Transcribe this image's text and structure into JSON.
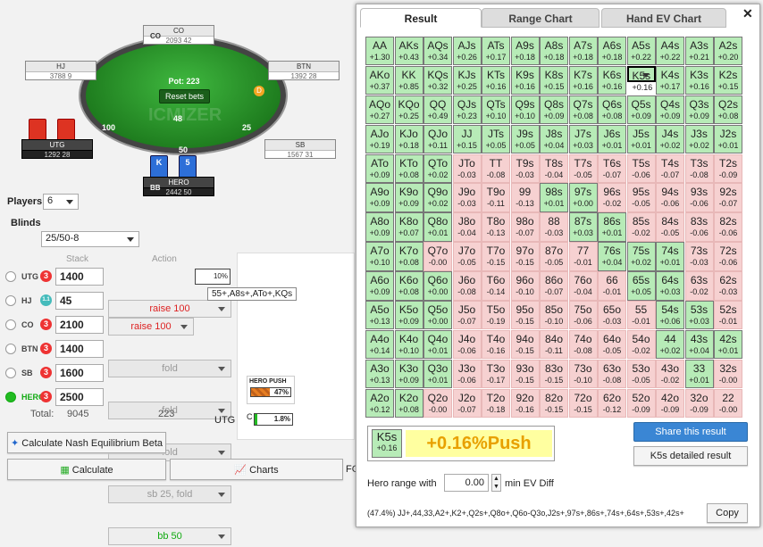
{
  "table": {
    "pot_label": "Pot: 223",
    "reset_label": "Reset bets",
    "center_chips": "48",
    "watermark": "ICMIZER",
    "dealer": "D",
    "bet_utg": "100",
    "bet_btn": "25",
    "bet_bb": "50",
    "seats": [
      {
        "pos": "CO",
        "name": "CO",
        "stack": "2093 42"
      },
      {
        "pos": "HJ",
        "name": "HJ",
        "stack": "3788 9"
      },
      {
        "pos": "BTN",
        "name": "BTN",
        "stack": "1392 28"
      },
      {
        "pos": "UTG",
        "name": "UTG",
        "stack": "1292 28"
      },
      {
        "pos": "SB",
        "name": "SB",
        "stack": "1567 31"
      },
      {
        "pos": "BB",
        "name": "HERO",
        "stack": "2442 50"
      }
    ],
    "hero_cards": [
      "K",
      "5"
    ]
  },
  "controls": {
    "players_label": "Players",
    "players_value": "6",
    "blinds_label": "Blinds",
    "blinds_value": "25/50-8",
    "stack_header": "Stack",
    "action_header": "Action",
    "rows": [
      {
        "pos": "UTG",
        "badge": "3",
        "stack": "1400",
        "action": "raise 100",
        "pct": "10%"
      },
      {
        "pos": "HJ",
        "badge": "1.1",
        "stack": "45",
        "action": "fold"
      },
      {
        "pos": "CO",
        "badge": "3",
        "stack": "2100",
        "action": "fold"
      },
      {
        "pos": "BTN",
        "badge": "3",
        "stack": "1400",
        "action": "fold"
      },
      {
        "pos": "SB",
        "badge": "3",
        "stack": "1600",
        "action": "sb 25, fold"
      },
      {
        "pos": "HERO",
        "badge": "3",
        "stack": "2500",
        "action": "bb 50"
      }
    ],
    "total_label": "Total:",
    "total_stack": "9045",
    "total_action": "223",
    "tooltip": "55+,A8s+,ATo+,KQs",
    "hero_push_label": "HERO PUSH",
    "hero_push_pct": "47%",
    "utg_label": "UTG",
    "call_label": "C",
    "call_pct": "1.8%",
    "nash_button": "Calculate Nash Equilibrium Beta",
    "calculate_button": "Calculate",
    "charts_button": "Charts",
    "fc_label": "FC"
  },
  "panel": {
    "tabs": [
      "Result",
      "Range Chart",
      "Hand EV Chart"
    ],
    "close": "✕",
    "grid": [
      [
        [
          "AA",
          "+1.30",
          "g"
        ],
        [
          "AKs",
          "+0.43",
          "g"
        ],
        [
          "AQs",
          "+0.34",
          "g"
        ],
        [
          "AJs",
          "+0.26",
          "g"
        ],
        [
          "ATs",
          "+0.17",
          "g"
        ],
        [
          "A9s",
          "+0.18",
          "g"
        ],
        [
          "A8s",
          "+0.18",
          "g"
        ],
        [
          "A7s",
          "+0.18",
          "g"
        ],
        [
          "A6s",
          "+0.18",
          "g"
        ],
        [
          "A5s",
          "+0.22",
          "g"
        ],
        [
          "A4s",
          "+0.22",
          "g"
        ],
        [
          "A3s",
          "+0.21",
          "g"
        ],
        [
          "A2s",
          "+0.20",
          "g"
        ]
      ],
      [
        [
          "AKo",
          "+0.37",
          "g"
        ],
        [
          "KK",
          "+0.85",
          "g"
        ],
        [
          "KQs",
          "+0.32",
          "g"
        ],
        [
          "KJs",
          "+0.25",
          "g"
        ],
        [
          "KTs",
          "+0.16",
          "g"
        ],
        [
          "K9s",
          "+0.16",
          "g"
        ],
        [
          "K8s",
          "+0.15",
          "g"
        ],
        [
          "K7s",
          "+0.16",
          "g"
        ],
        [
          "K6s",
          "+0.16",
          "g"
        ],
        [
          "K5s",
          "+0.16",
          "gs"
        ],
        [
          "K4s",
          "+0.17",
          "g"
        ],
        [
          "K3s",
          "+0.16",
          "g"
        ],
        [
          "K2s",
          "+0.15",
          "g"
        ]
      ],
      [
        [
          "AQo",
          "+0.27",
          "g"
        ],
        [
          "KQo",
          "+0.25",
          "g"
        ],
        [
          "QQ",
          "+0.49",
          "g"
        ],
        [
          "QJs",
          "+0.23",
          "g"
        ],
        [
          "QTs",
          "+0.10",
          "g"
        ],
        [
          "Q9s",
          "+0.10",
          "g"
        ],
        [
          "Q8s",
          "+0.09",
          "g"
        ],
        [
          "Q7s",
          "+0.08",
          "g"
        ],
        [
          "Q6s",
          "+0.08",
          "g"
        ],
        [
          "Q5s",
          "+0.09",
          "g"
        ],
        [
          "Q4s",
          "+0.09",
          "g"
        ],
        [
          "Q3s",
          "+0.09",
          "g"
        ],
        [
          "Q2s",
          "+0.08",
          "g"
        ]
      ],
      [
        [
          "AJo",
          "+0.19",
          "g"
        ],
        [
          "KJo",
          "+0.18",
          "g"
        ],
        [
          "QJo",
          "+0.11",
          "g"
        ],
        [
          "JJ",
          "+0.15",
          "g"
        ],
        [
          "JTs",
          "+0.05",
          "g"
        ],
        [
          "J9s",
          "+0.05",
          "g"
        ],
        [
          "J8s",
          "+0.04",
          "g"
        ],
        [
          "J7s",
          "+0.03",
          "g"
        ],
        [
          "J6s",
          "+0.01",
          "g"
        ],
        [
          "J5s",
          "+0.01",
          "g"
        ],
        [
          "J4s",
          "+0.02",
          "g"
        ],
        [
          "J3s",
          "+0.02",
          "g"
        ],
        [
          "J2s",
          "+0.01",
          "g"
        ]
      ],
      [
        [
          "ATo",
          "+0.09",
          "g"
        ],
        [
          "KTo",
          "+0.08",
          "g"
        ],
        [
          "QTo",
          "+0.02",
          "g"
        ],
        [
          "JTo",
          "-0.03",
          "r"
        ],
        [
          "TT",
          "-0.08",
          "r"
        ],
        [
          "T9s",
          "-0.03",
          "r"
        ],
        [
          "T8s",
          "-0.04",
          "r"
        ],
        [
          "T7s",
          "-0.05",
          "r"
        ],
        [
          "T6s",
          "-0.07",
          "r"
        ],
        [
          "T5s",
          "-0.06",
          "r"
        ],
        [
          "T4s",
          "-0.07",
          "r"
        ],
        [
          "T3s",
          "-0.08",
          "r"
        ],
        [
          "T2s",
          "-0.09",
          "r"
        ]
      ],
      [
        [
          "A9o",
          "+0.09",
          "g"
        ],
        [
          "K9o",
          "+0.09",
          "g"
        ],
        [
          "Q9o",
          "+0.02",
          "g"
        ],
        [
          "J9o",
          "-0.03",
          "r"
        ],
        [
          "T9o",
          "-0.11",
          "r"
        ],
        [
          "99",
          "-0.13",
          "r"
        ],
        [
          "98s",
          "+0.01",
          "g"
        ],
        [
          "97s",
          "+0.00",
          "g"
        ],
        [
          "96s",
          "-0.02",
          "r"
        ],
        [
          "95s",
          "-0.05",
          "r"
        ],
        [
          "94s",
          "-0.06",
          "r"
        ],
        [
          "93s",
          "-0.06",
          "r"
        ],
        [
          "92s",
          "-0.07",
          "r"
        ]
      ],
      [
        [
          "A8o",
          "+0.09",
          "g"
        ],
        [
          "K8o",
          "+0.07",
          "g"
        ],
        [
          "Q8o",
          "+0.01",
          "g"
        ],
        [
          "J8o",
          "-0.04",
          "r"
        ],
        [
          "T8o",
          "-0.13",
          "r"
        ],
        [
          "98o",
          "-0.07",
          "r"
        ],
        [
          "88",
          "-0.03",
          "r"
        ],
        [
          "87s",
          "+0.03",
          "g"
        ],
        [
          "86s",
          "+0.01",
          "g"
        ],
        [
          "85s",
          "-0.02",
          "r"
        ],
        [
          "84s",
          "-0.05",
          "r"
        ],
        [
          "83s",
          "-0.06",
          "r"
        ],
        [
          "82s",
          "-0.06",
          "r"
        ]
      ],
      [
        [
          "A7o",
          "+0.10",
          "g"
        ],
        [
          "K7o",
          "+0.08",
          "g"
        ],
        [
          "Q7o",
          "-0.00",
          "r"
        ],
        [
          "J7o",
          "-0.05",
          "r"
        ],
        [
          "T7o",
          "-0.15",
          "r"
        ],
        [
          "97o",
          "-0.15",
          "r"
        ],
        [
          "87o",
          "-0.05",
          "r"
        ],
        [
          "77",
          "-0.01",
          "r"
        ],
        [
          "76s",
          "+0.04",
          "g"
        ],
        [
          "75s",
          "+0.02",
          "g"
        ],
        [
          "74s",
          "+0.01",
          "g"
        ],
        [
          "73s",
          "-0.03",
          "r"
        ],
        [
          "72s",
          "-0.06",
          "r"
        ]
      ],
      [
        [
          "A6o",
          "+0.09",
          "g"
        ],
        [
          "K6o",
          "+0.08",
          "g"
        ],
        [
          "Q6o",
          "+0.00",
          "g"
        ],
        [
          "J6o",
          "-0.08",
          "r"
        ],
        [
          "T6o",
          "-0.14",
          "r"
        ],
        [
          "96o",
          "-0.10",
          "r"
        ],
        [
          "86o",
          "-0.07",
          "r"
        ],
        [
          "76o",
          "-0.04",
          "r"
        ],
        [
          "66",
          "-0.01",
          "r"
        ],
        [
          "65s",
          "+0.05",
          "g"
        ],
        [
          "64s",
          "+0.03",
          "g"
        ],
        [
          "63s",
          "-0.02",
          "r"
        ],
        [
          "62s",
          "-0.03",
          "r"
        ]
      ],
      [
        [
          "A5o",
          "+0.13",
          "g"
        ],
        [
          "K5o",
          "+0.09",
          "g"
        ],
        [
          "Q5o",
          "+0.00",
          "g"
        ],
        [
          "J5o",
          "-0.07",
          "r"
        ],
        [
          "T5o",
          "-0.19",
          "r"
        ],
        [
          "95o",
          "-0.15",
          "r"
        ],
        [
          "85o",
          "-0.10",
          "r"
        ],
        [
          "75o",
          "-0.06",
          "r"
        ],
        [
          "65o",
          "-0.03",
          "r"
        ],
        [
          "55",
          "-0.01",
          "r"
        ],
        [
          "54s",
          "+0.06",
          "g"
        ],
        [
          "53s",
          "+0.03",
          "g"
        ],
        [
          "52s",
          "-0.01",
          "r"
        ]
      ],
      [
        [
          "A4o",
          "+0.14",
          "g"
        ],
        [
          "K4o",
          "+0.10",
          "g"
        ],
        [
          "Q4o",
          "+0.01",
          "g"
        ],
        [
          "J4o",
          "-0.06",
          "r"
        ],
        [
          "T4o",
          "-0.16",
          "r"
        ],
        [
          "94o",
          "-0.15",
          "r"
        ],
        [
          "84o",
          "-0.11",
          "r"
        ],
        [
          "74o",
          "-0.08",
          "r"
        ],
        [
          "64o",
          "-0.05",
          "r"
        ],
        [
          "54o",
          "-0.02",
          "r"
        ],
        [
          "44",
          "+0.02",
          "g"
        ],
        [
          "43s",
          "+0.04",
          "g"
        ],
        [
          "42s",
          "+0.01",
          "g"
        ]
      ],
      [
        [
          "A3o",
          "+0.13",
          "g"
        ],
        [
          "K3o",
          "+0.09",
          "g"
        ],
        [
          "Q3o",
          "+0.01",
          "g"
        ],
        [
          "J3o",
          "-0.06",
          "r"
        ],
        [
          "T3o",
          "-0.17",
          "r"
        ],
        [
          "93o",
          "-0.15",
          "r"
        ],
        [
          "83o",
          "-0.15",
          "r"
        ],
        [
          "73o",
          "-0.10",
          "r"
        ],
        [
          "63o",
          "-0.08",
          "r"
        ],
        [
          "53o",
          "-0.05",
          "r"
        ],
        [
          "43o",
          "-0.02",
          "r"
        ],
        [
          "33",
          "+0.01",
          "g"
        ],
        [
          "32s",
          "-0.00",
          "r"
        ]
      ],
      [
        [
          "A2o",
          "+0.12",
          "g"
        ],
        [
          "K2o",
          "+0.08",
          "g"
        ],
        [
          "Q2o",
          "-0.00",
          "r"
        ],
        [
          "J2o",
          "-0.07",
          "r"
        ],
        [
          "T2o",
          "-0.18",
          "r"
        ],
        [
          "92o",
          "-0.16",
          "r"
        ],
        [
          "82o",
          "-0.15",
          "r"
        ],
        [
          "72o",
          "-0.15",
          "r"
        ],
        [
          "62o",
          "-0.12",
          "r"
        ],
        [
          "52o",
          "-0.09",
          "r"
        ],
        [
          "42o",
          "-0.09",
          "r"
        ],
        [
          "32o",
          "-0.09",
          "r"
        ],
        [
          "22",
          "-0.00",
          "r"
        ]
      ]
    ],
    "result_hand": "K5s",
    "result_ev": "+0.16",
    "result_text": "+0.16%Push",
    "share_button": "Share this result",
    "detail_button": "K5s detailed result",
    "hero_range_label": "Hero range with",
    "ev_value": "0.00",
    "ev_unit": "min EV Diff",
    "range_text": "(47.4%) JJ+,44,33,A2+,K2+,Q2s+,Q8o+,Q6o-Q3o,J2s+,97s+,86s+,74s+,64s+,53s+,42s+",
    "copy_button": "Copy"
  }
}
